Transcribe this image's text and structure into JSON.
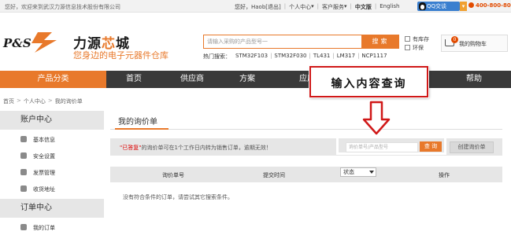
{
  "topbar": {
    "welcome": "您好，欢迎来到武汉力源信息技术股份有限公司",
    "greeting": "您好，Haob",
    "logout": "[退出]",
    "user_center": "个人中心",
    "customer_service": "客户服务",
    "lang_cn": "中文版",
    "lang_en": "English",
    "qq_label": "QQ交谈",
    "phone": "400-800-8051"
  },
  "header": {
    "logo_text": "P&S",
    "brand_name_a": "力源",
    "brand_name_b": "芯",
    "brand_name_c": "城",
    "slogan": "您身边的电子元器件仓库",
    "search_placeholder": "请输入采购的产品型号一",
    "search_button": "搜索",
    "in_stock_label": "有库存",
    "eco_label": "环保",
    "hot_label": "热门搜索：",
    "hot_terms": [
      "STM32F103",
      "STM32F030",
      "TL431",
      "LM317",
      "NCP1117"
    ],
    "cart_count": "0",
    "cart_label": "我的购物车"
  },
  "nav": {
    "category": "产品分类",
    "items": [
      "首页",
      "供应商",
      "方案",
      "应用",
      "帮助"
    ]
  },
  "breadcrumb": [
    "首页",
    "个人中心",
    "我的询价单"
  ],
  "sidebar": {
    "account_header": "账户中心",
    "account_items": [
      "基本信息",
      "安全设置",
      "发票管理",
      "收货地址"
    ],
    "order_header": "订单中心",
    "order_items": [
      "我的订单"
    ]
  },
  "main": {
    "title": "我的询价单",
    "notice_red": "\"已答复\"",
    "notice_rest": "的询价单可在1个工作日内转为销售订单，逾期无效！",
    "query_placeholder": "询价单号/产品型号",
    "query_button": "查 询",
    "create_button": "创建询价单",
    "columns": {
      "inquiry_no": "询价单号",
      "submit_time": "提交时间",
      "status": "状态",
      "actions": "操作"
    },
    "empty_message": "没有符合条件的订单，请尝试其它搜索条件。"
  },
  "annotation": {
    "text": "输入内容查询"
  },
  "colors": {
    "accent": "#e8792b",
    "nav_bg": "#3a3a3a",
    "callout_border": "#d01818"
  }
}
